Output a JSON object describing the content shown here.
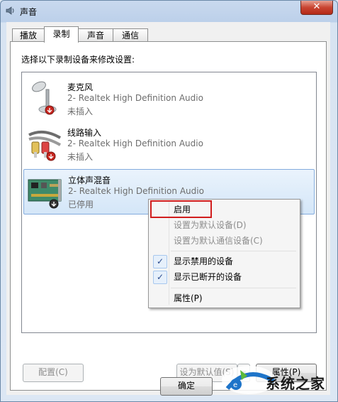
{
  "window": {
    "title": "声音",
    "close_glyph": "✕"
  },
  "tabs": [
    {
      "label": "播放",
      "active": false
    },
    {
      "label": "录制",
      "active": true
    },
    {
      "label": "声音",
      "active": false
    },
    {
      "label": "通信",
      "active": false
    }
  ],
  "instruction": "选择以下录制设备来修改设置:",
  "devices": [
    {
      "name": "麦克风",
      "description": "2- Realtek High Definition Audio",
      "status": "未插入",
      "icon": "microphone-icon"
    },
    {
      "name": "线路输入",
      "description": "2- Realtek High Definition Audio",
      "status": "未插入",
      "icon": "line-in-cable-icon"
    },
    {
      "name": "立体声混音",
      "description": "2- Realtek High Definition Audio",
      "status": "已停用",
      "icon": "sound-card-icon",
      "selected": true
    }
  ],
  "context_menu": {
    "items": [
      {
        "label": "启用",
        "enabled": true
      },
      {
        "label": "设置为默认设备(D)",
        "enabled": false
      },
      {
        "label": "设置为默认通信设备(C)",
        "enabled": false
      },
      {
        "label": "显示禁用的设备",
        "enabled": true,
        "checked": true
      },
      {
        "label": "显示已断开的设备",
        "enabled": true,
        "checked": true
      },
      {
        "label": "属性(P)",
        "enabled": true
      }
    ]
  },
  "buttons": {
    "configure": "配置(C)",
    "set_default": "设为默认值(S)",
    "properties": "属性(P)",
    "ok": "确定"
  },
  "watermark": {
    "text": "系统之家"
  },
  "colors": {
    "accent": "#84acdd",
    "highlight_red": "#d11d1d",
    "check_blue": "#2a4a8c"
  }
}
